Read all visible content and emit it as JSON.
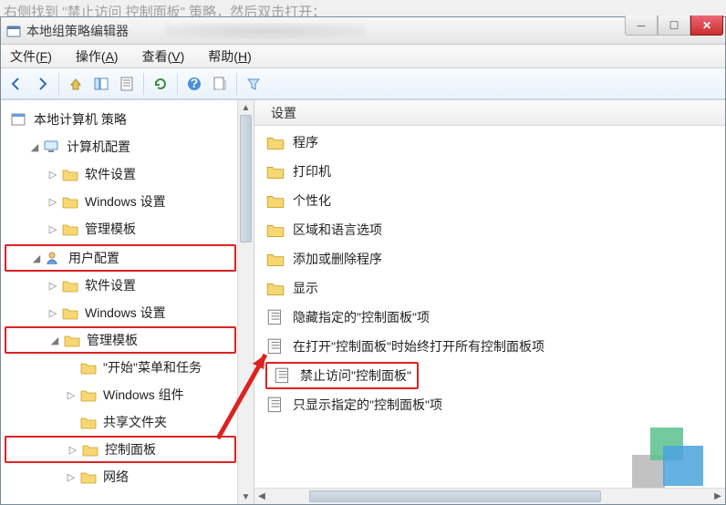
{
  "instruction_text": "右侧找到 \"禁止访问 控制面板\" 策略，然后双击打开；",
  "window": {
    "title": "本地组策略编辑器"
  },
  "menu": {
    "file": {
      "label": "文件",
      "acc": "F"
    },
    "action": {
      "label": "操作",
      "acc": "A"
    },
    "view": {
      "label": "查看",
      "acc": "V"
    },
    "help": {
      "label": "帮助",
      "acc": "H"
    }
  },
  "tree": {
    "root": "本地计算机 策略",
    "computer_config": "计算机配置",
    "computer_children": {
      "software_settings": "软件设置",
      "windows_settings": "Windows 设置",
      "admin_templates": "管理模板"
    },
    "user_config": "用户配置",
    "user_children": {
      "software_settings": "软件设置",
      "windows_settings": "Windows 设置",
      "admin_templates": "管理模板",
      "admin_children": {
        "start_menu": "\"开始\"菜单和任务",
        "windows_components": "Windows 组件",
        "shared_folders": "共享文件夹",
        "control_panel": "控制面板",
        "network": "网络"
      }
    }
  },
  "right": {
    "column_header": "设置",
    "folders": {
      "programs": "程序",
      "printers": "打印机",
      "personalization": "个性化",
      "region_language": "区域和语言选项",
      "add_remove_programs": "添加或删除程序",
      "display": "显示"
    },
    "policies": {
      "hide_specified": "隐藏指定的\"控制面板\"项",
      "always_open_all": "在打开\"控制面板\"时始终打开所有控制面板项",
      "prohibit_access": "禁止访问\"控制面板\"",
      "show_only_specified": "只显示指定的\"控制面板\"项"
    }
  }
}
